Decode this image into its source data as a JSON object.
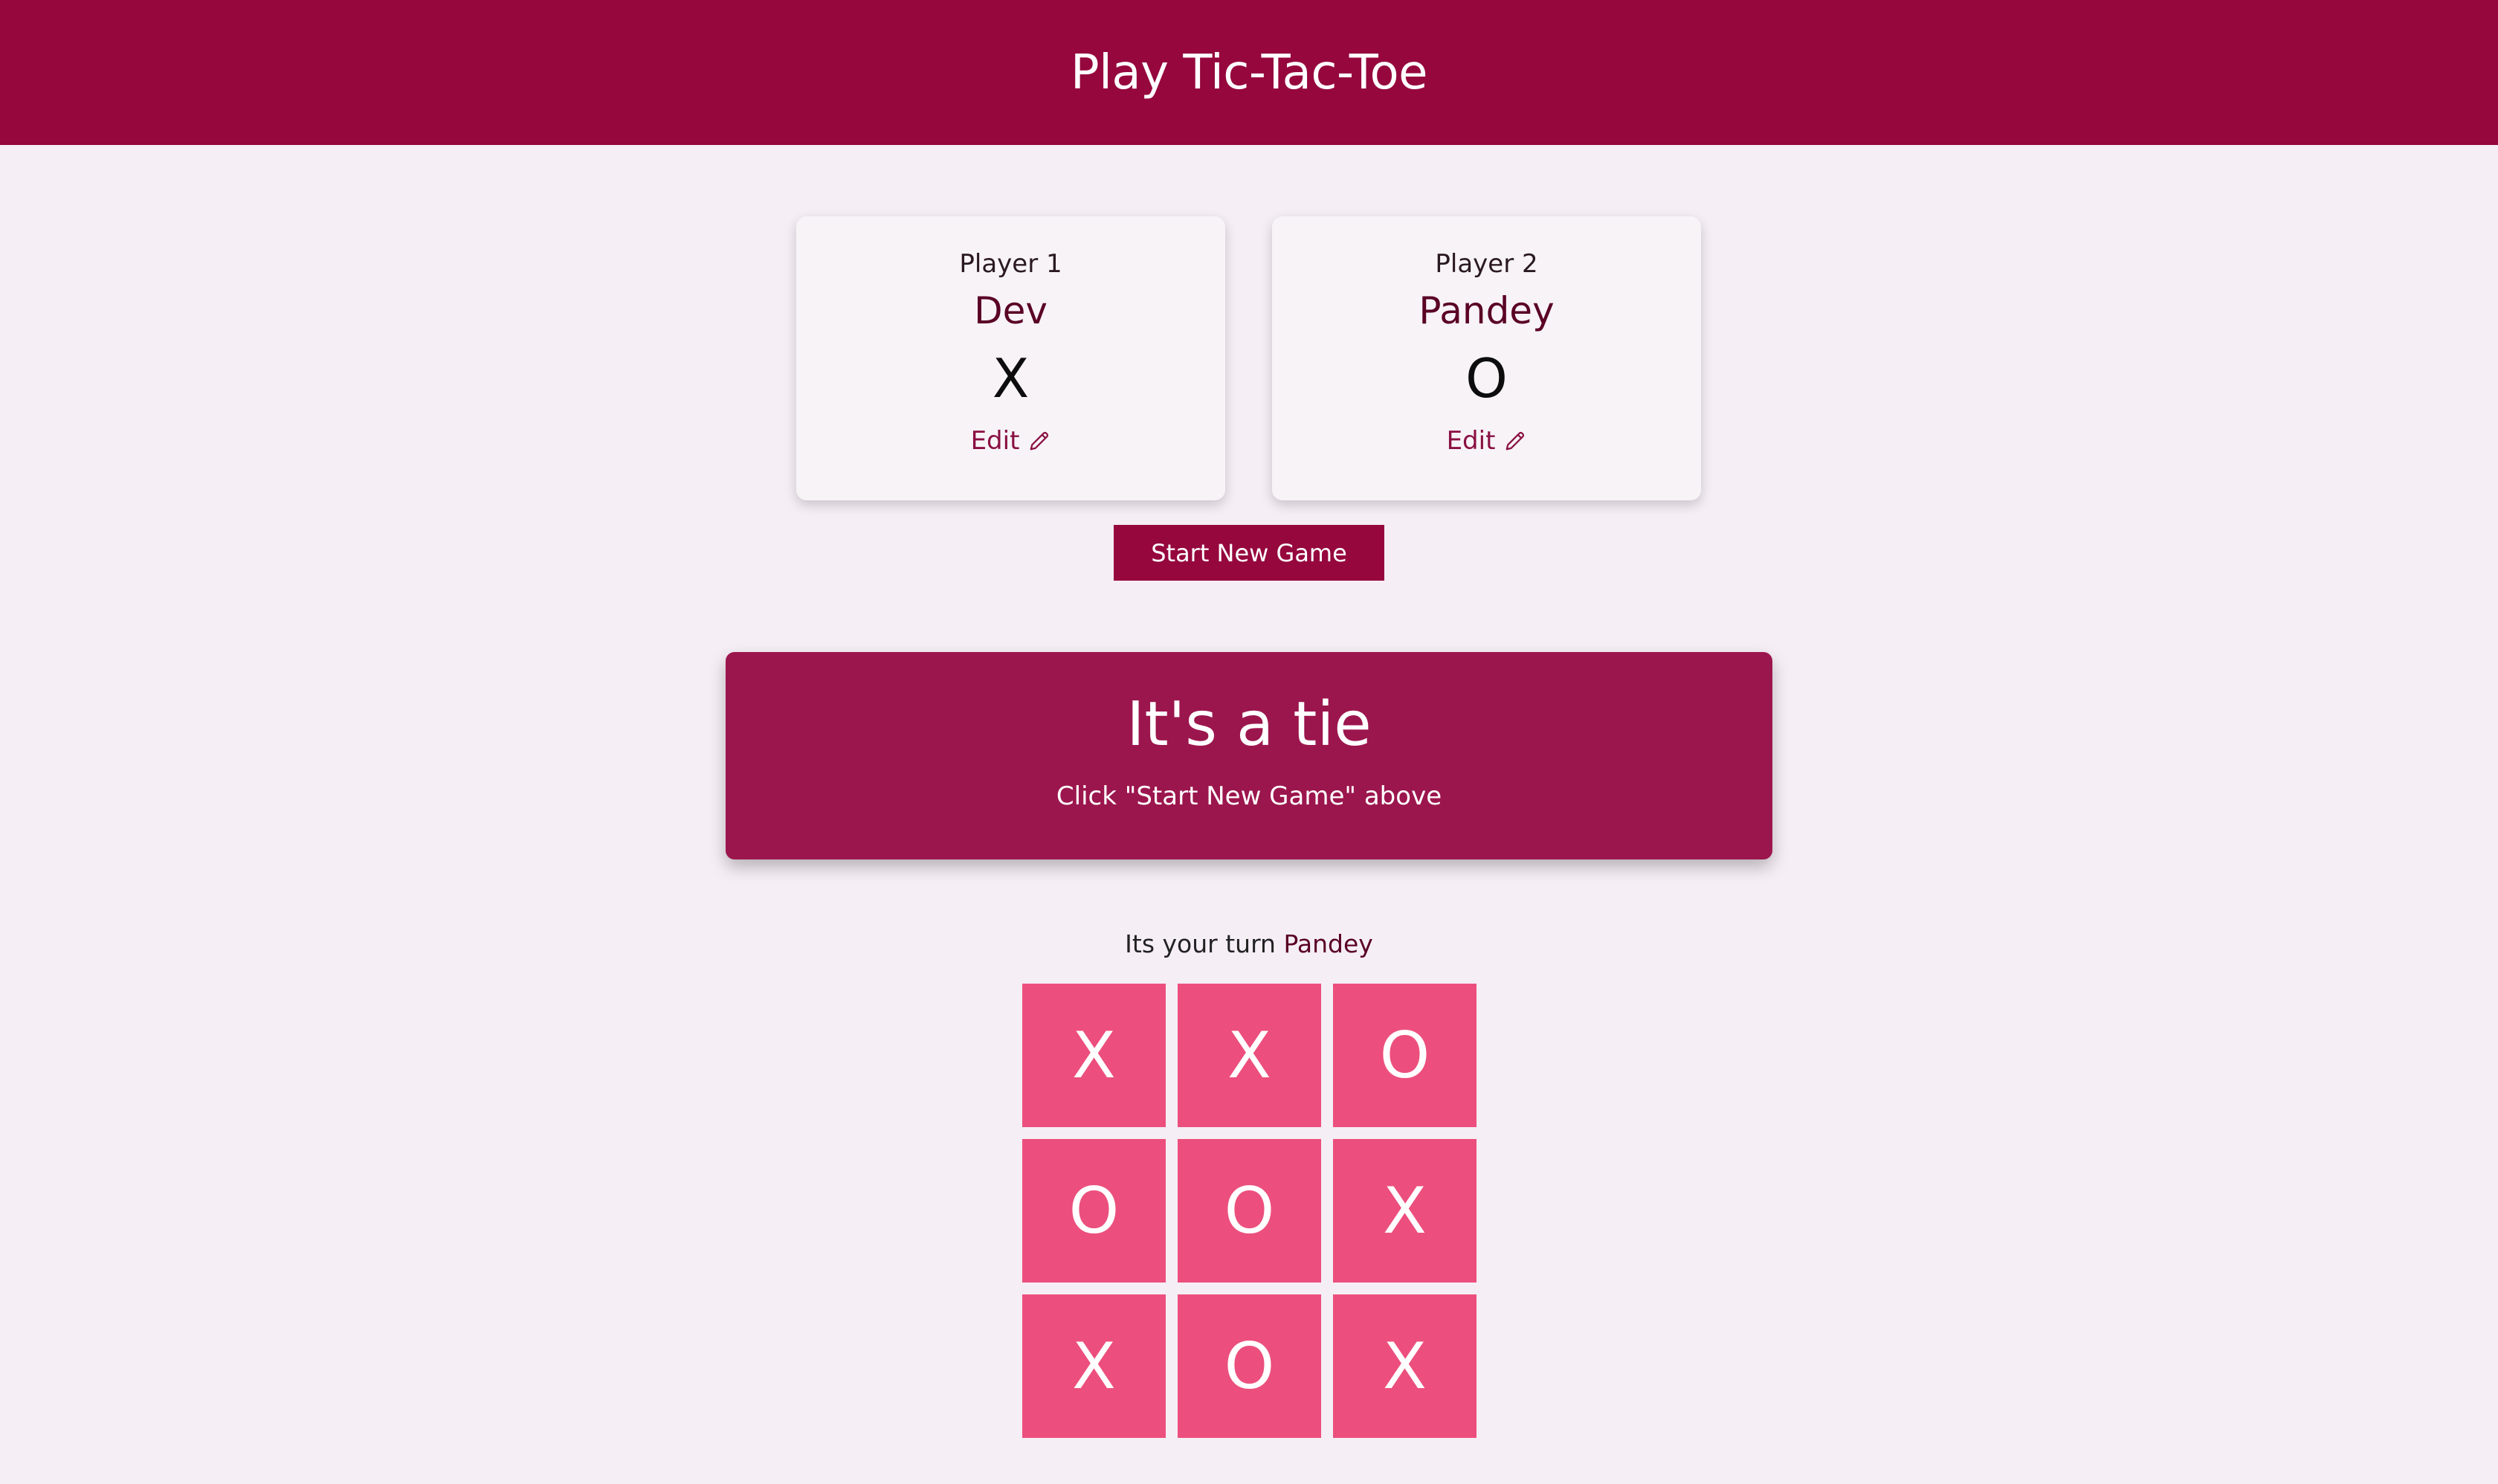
{
  "header": {
    "title": "Play Tic-Tac-Toe"
  },
  "players": [
    {
      "role": "Player 1",
      "name": "Dev",
      "symbol": "X",
      "edit_label": "Edit",
      "edit_icon": "pencil-icon"
    },
    {
      "role": "Player 2",
      "name": "Pandey",
      "symbol": "O",
      "edit_label": "Edit",
      "edit_icon": "pencil-icon"
    }
  ],
  "start_button": {
    "label": "Start New Game"
  },
  "result": {
    "title": "It's a tie",
    "subtitle": "Click \"Start New Game\" above"
  },
  "turn": {
    "prefix": "Its your turn",
    "player": "Pandey"
  },
  "board": {
    "cells": [
      "X",
      "X",
      "O",
      "O",
      "O",
      "X",
      "X",
      "O",
      "X"
    ]
  },
  "colors": {
    "header_bg": "#96073e",
    "page_bg": "#f5eef5",
    "result_bg": "#9c164e",
    "cell_bg": "#ec4f7d",
    "accent_text": "#5a0124"
  }
}
